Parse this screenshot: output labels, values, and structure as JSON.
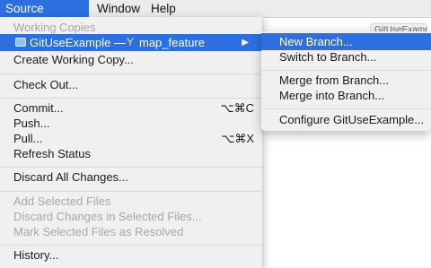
{
  "menubar": {
    "items": [
      {
        "label": "Source Control"
      },
      {
        "label": "Window"
      },
      {
        "label": "Help"
      }
    ]
  },
  "background": {
    "window_title": "GitUseExample"
  },
  "menu": {
    "items": [
      {
        "label": "Working Copies"
      },
      {
        "label": "GitUseExample — ",
        "branch": "map_feature"
      },
      {
        "label": "Create Working Copy..."
      },
      {
        "label": "Check Out..."
      },
      {
        "label": "Commit...",
        "shortcut": "⌥⌘C"
      },
      {
        "label": "Push..."
      },
      {
        "label": "Pull...",
        "shortcut": "⌥⌘X"
      },
      {
        "label": "Refresh Status"
      },
      {
        "label": "Discard All Changes..."
      },
      {
        "label": "Add Selected Files"
      },
      {
        "label": "Discard Changes in Selected Files..."
      },
      {
        "label": "Mark Selected Files as Resolved"
      },
      {
        "label": "History..."
      }
    ],
    "submenu_arrow": "▶"
  },
  "submenu": {
    "items": [
      {
        "label": "New Branch..."
      },
      {
        "label": "Switch to Branch..."
      },
      {
        "label": "Merge from Branch..."
      },
      {
        "label": "Merge into Branch..."
      },
      {
        "label": "Configure GitUseExample..."
      }
    ]
  },
  "colors": {
    "selection": "#2c6fe0",
    "menu_bg": "#f0f0f0",
    "disabled_text": "#a7a7a7",
    "branch_icon": "#ffe083"
  },
  "icons": [
    "folder-icon",
    "branch-icon",
    "submenu-arrow-icon"
  ]
}
